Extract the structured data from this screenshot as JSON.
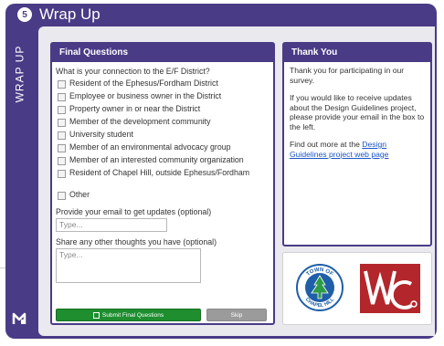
{
  "header": {
    "step": "5",
    "title": "Wrap Up"
  },
  "sidebar": {
    "label": "WRAP UP"
  },
  "questions_panel": {
    "title": "Final Questions",
    "prompt": "What is your connection to the E/F District?",
    "options": [
      "Resident of the Ephesus/Fordham District",
      "Employee or business owner in the District",
      "Property owner in or near the District",
      "Member of the development community",
      "University student",
      "Member of an environmental advocacy group",
      "Member of an interested community organization",
      "Resident of Chapel Hill, outside Ephesus/Fordham",
      "Other"
    ],
    "email_label": "Provide your email to get updates (optional)",
    "email_placeholder": "Type...",
    "thoughts_label": "Share any other thoughts you have (optional)",
    "thoughts_placeholder": "Type...",
    "submit_label": "Submit Final Questions",
    "skip_label": "Skip"
  },
  "thank_panel": {
    "title": "Thank You",
    "para1": "Thank you for participating in our survey.",
    "para2": "If you would like to receive updates about the Design Guidelines project, please provide your email in the box to the left.",
    "para3_prefix": "Find out more at the ",
    "para3_link": "Design Guidelines project web page"
  },
  "logos": {
    "town_top": "TOWN OF",
    "town_bottom": "CHAPEL HILL"
  },
  "colors": {
    "primary": "#4a3b86",
    "submit": "#1e8e2f",
    "skip": "#9b9b9b",
    "link": "#1a55c9",
    "logo_red": "#b3262b",
    "logo_blue": "#1f5fa8"
  }
}
